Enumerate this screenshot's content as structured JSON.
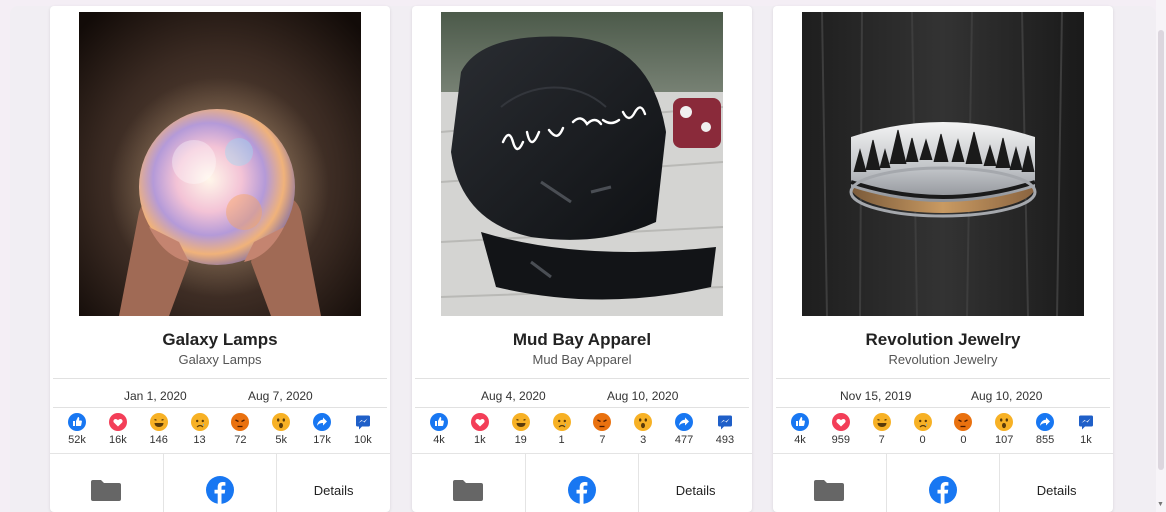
{
  "cards": [
    {
      "title": "Galaxy Lamps",
      "subtitle": "Galaxy Lamps",
      "date_start": "Jan 1, 2020",
      "date_end": "Aug 7, 2020",
      "reactions": [
        "52k",
        "16k",
        "146",
        "13",
        "72",
        "5k",
        "17k",
        "10k"
      ],
      "details_label": "Details"
    },
    {
      "title": "Mud Bay Apparel",
      "subtitle": "Mud Bay Apparel",
      "date_start": "Aug 4, 2020",
      "date_end": "Aug 10, 2020",
      "reactions": [
        "4k",
        "1k",
        "19",
        "1",
        "7",
        "3",
        "477",
        "493"
      ],
      "details_label": "Details"
    },
    {
      "title": "Revolution Jewelry",
      "subtitle": "Revolution Jewelry",
      "date_start": "Nov 15, 2019",
      "date_end": "Aug 10, 2020",
      "reactions": [
        "4k",
        "959",
        "7",
        "0",
        "0",
        "107",
        "855",
        "1k"
      ],
      "details_label": "Details"
    }
  ],
  "reaction_icons": [
    "like-icon",
    "love-icon",
    "haha-icon",
    "sad-icon",
    "angry-icon",
    "wow-icon",
    "share-icon",
    "comment-icon"
  ],
  "colors": {
    "facebook_blue": "#1877f2",
    "love_red": "#f33e58",
    "emoji_yellow": "#f7b125",
    "angry_orange": "#e9710f",
    "folder_gray": "#666666"
  }
}
